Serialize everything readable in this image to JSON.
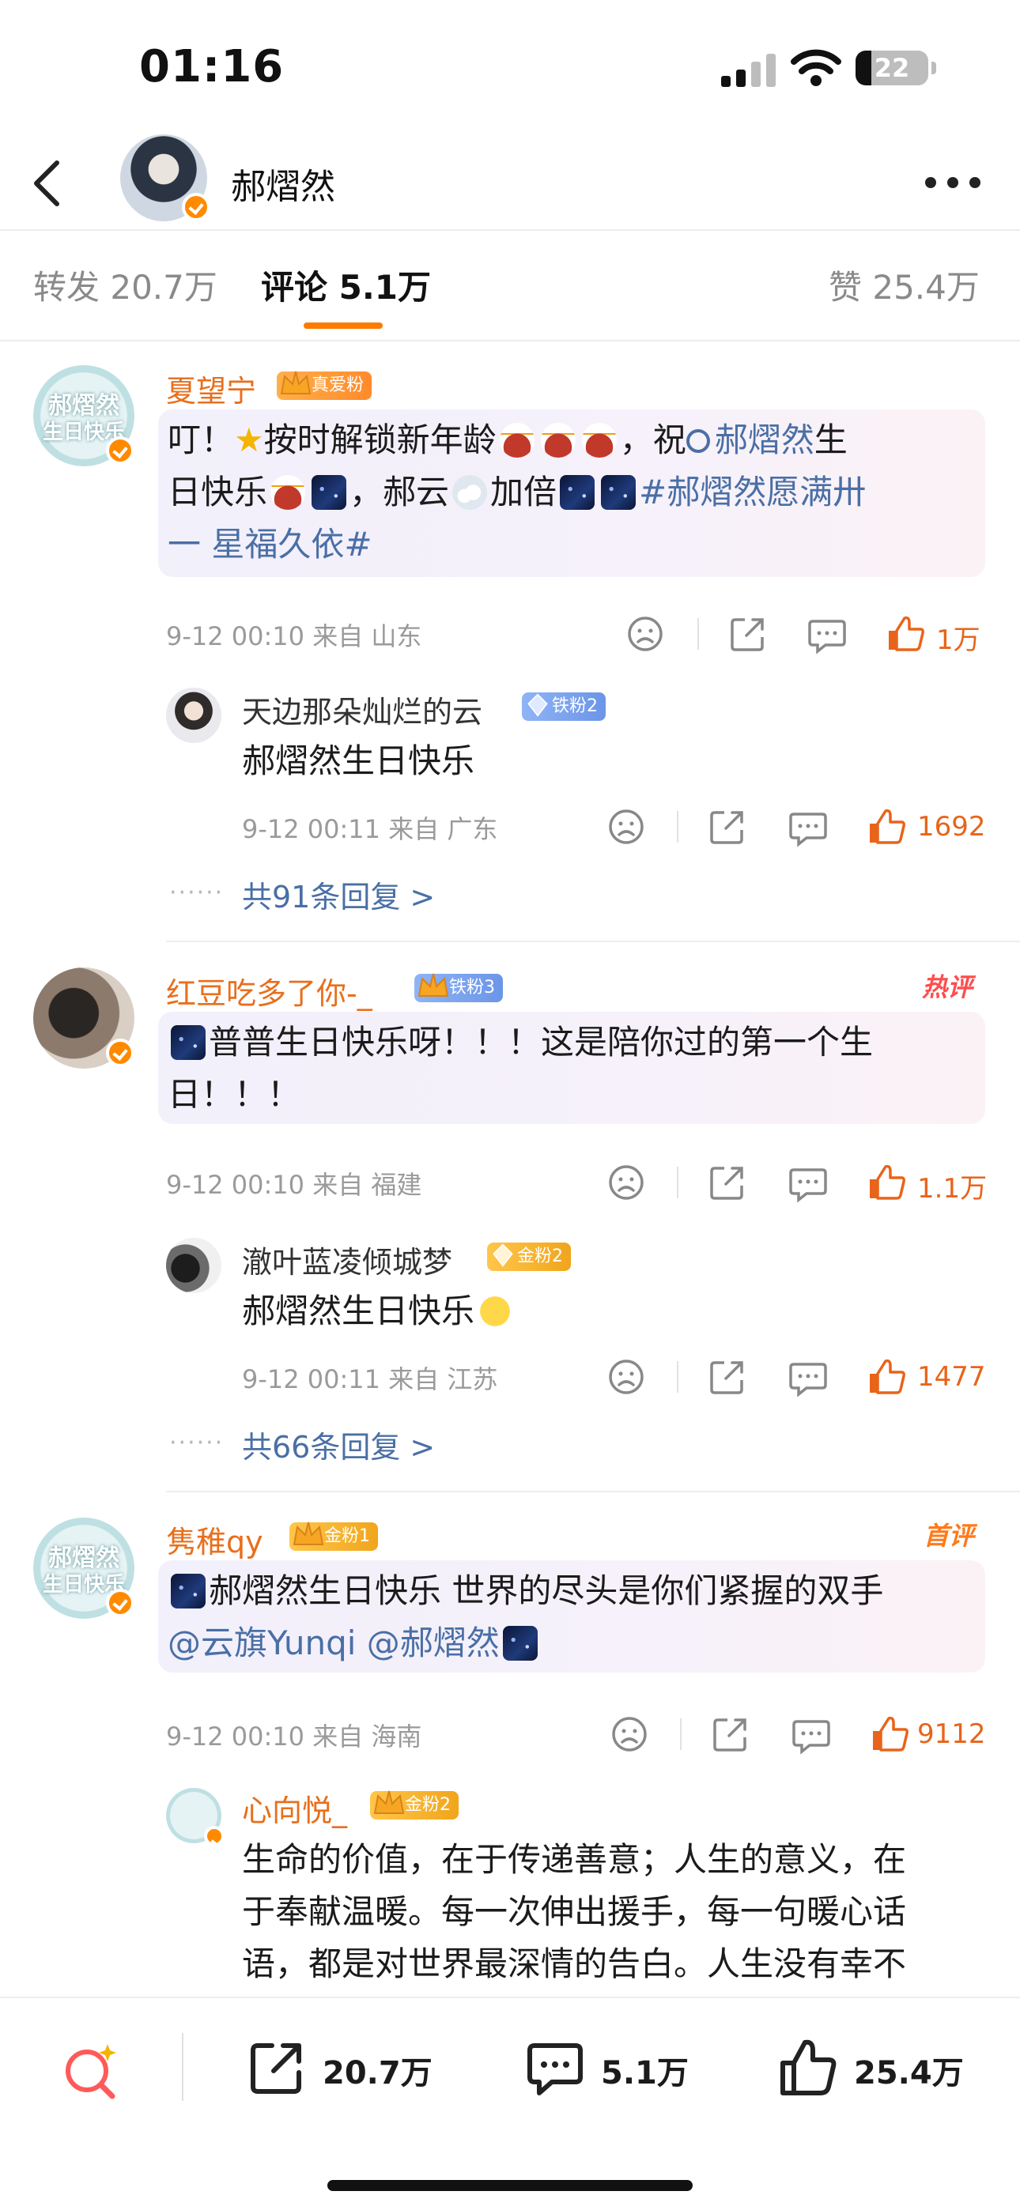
{
  "status": {
    "time": "01:16",
    "battery": "22",
    "battery_level": 0.22
  },
  "header": {
    "name": "郝熠然"
  },
  "tabs": [
    {
      "label": "转发 20.7万"
    },
    {
      "label": "评论 5.1万"
    },
    {
      "label": "赞 25.4万"
    }
  ],
  "comments": [
    {
      "author": "夏望宁",
      "badge": "真爱粉",
      "avatar_text": [
        "郝熠然",
        "生日快乐"
      ],
      "text_parts": [
        "叮！",
        "按时解锁新年龄",
        "，祝",
        "郝熠然",
        "生",
        "日快乐",
        "，郝云",
        "加倍",
        "#郝熠然愿满卅",
        "一 星福久依#"
      ],
      "meta": "9-12 00:10 来自 山东",
      "likes": "1万",
      "reply": {
        "author": "天边那朵灿烂的云",
        "badge": "铁粉2",
        "text": "郝熠然生日快乐",
        "meta": "9-12 00:11 来自 广东",
        "likes": "1692"
      },
      "more_replies": "共91条回复 >"
    },
    {
      "author": "红豆吃多了你-_",
      "badge": "铁粉3",
      "tag": "热评",
      "text_parts": [
        "普普生日快乐呀！！！这是陪你过的第一个生",
        "日！！！"
      ],
      "meta": "9-12 00:10 来自 福建",
      "likes": "1.1万",
      "reply": {
        "author": "澈叶蓝凌倾城梦",
        "badge": "金粉2",
        "text": "郝熠然生日快乐",
        "meta": "9-12 00:11 来自 江苏",
        "likes": "1477"
      },
      "more_replies": "共66条回复 >"
    },
    {
      "author": "隽稚qy",
      "badge": "金粉1",
      "tag": "首评",
      "avatar_text": [
        "郝熠然",
        "生日快乐"
      ],
      "text_parts": [
        "郝熠然生日快乐 世界的尽头是你们紧握的双手",
        "@云旗Yunqi @郝熠然"
      ],
      "meta": "9-12 00:10 来自 海南",
      "likes": "9112",
      "reply": {
        "author": "心向悦_",
        "badge": "金粉2",
        "text_lines": [
          "生命的价值，在于传递善意；人生的意义，在",
          "于奉献温暖。每一次伸出援手，每一句暖心话",
          "语，都是对世界最深情的告白。人生没有幸不"
        ]
      }
    }
  ],
  "bottom_bar": {
    "repost": "20.7万",
    "comment": "5.1万",
    "like": "25.4万"
  },
  "icons": {
    "back": "chevron-left-icon",
    "more": "more-dots-icon",
    "dislike": "sad-face-icon",
    "share": "share-icon",
    "comment": "comment-bubble-icon",
    "like": "thumbs-up-icon",
    "search": "search-sparkle-icon"
  },
  "colors": {
    "accent": "#ff7a00",
    "author": "#e86f1c",
    "like": "#e8641a",
    "link": "#4a6fa5",
    "hot": "#ff4d4d"
  }
}
